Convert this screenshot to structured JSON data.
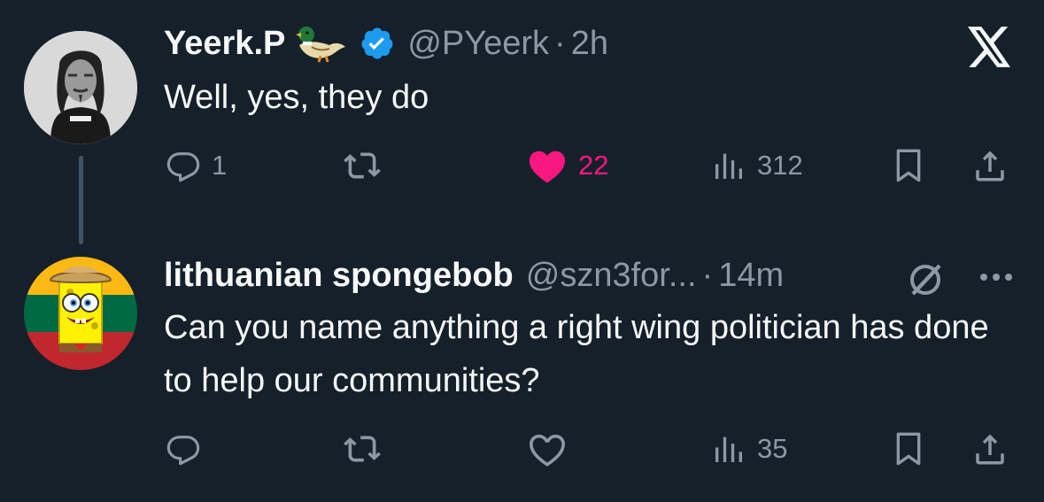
{
  "tweets": [
    {
      "name": "Yeerk.P",
      "name_emoji": "duck",
      "verified": true,
      "handle": "@PYeerk",
      "separator": "·",
      "time": "2h",
      "text": "Well, yes, they do",
      "replies": "1",
      "retweets": "",
      "likes": "22",
      "liked": true,
      "views": "312"
    },
    {
      "name": "lithuanian spongebob",
      "handle": "@szn3for...",
      "separator": "·",
      "time": "14m",
      "text": "Can you name anything a right wing politician has done to help our communities?",
      "replies": "",
      "retweets": "",
      "likes": "",
      "liked": false,
      "views": "35"
    }
  ],
  "icons": {
    "brand": "x-logo-icon",
    "reply": "reply-icon",
    "retweet": "retweet-icon",
    "like": "heart-icon",
    "views": "views-chart-icon",
    "bookmark": "bookmark-icon",
    "share": "share-icon",
    "grok": "grok-icon",
    "more": "more-icon"
  },
  "colors": {
    "background": "#15202b",
    "primary_text": "#f7f9f9",
    "secondary_text": "#8b98a5",
    "like_active": "#f91880",
    "verified": "#1d9bf0",
    "thread_line": "#425364"
  }
}
